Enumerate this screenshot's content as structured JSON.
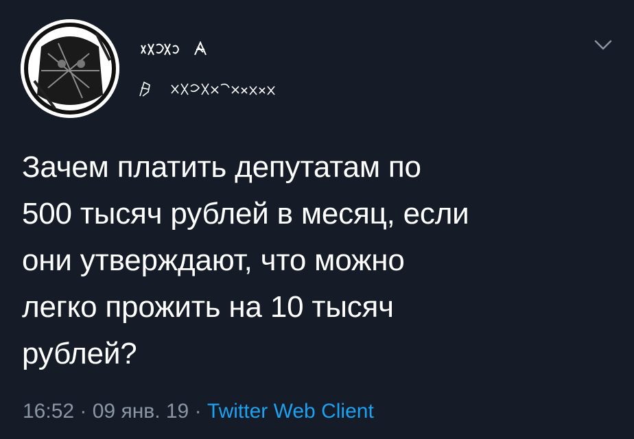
{
  "tweet": {
    "text": "Зачем платить депутатам по\n500 тысяч рублей в месяц, если\nони утверждают, что можно\nлегко прожить на 10 тысяч\nрублей?",
    "time": "16:52",
    "separator_1": " · ",
    "date": "09 янв. 19",
    "separator_2": " · ",
    "client": "Twitter Web Client"
  },
  "colors": {
    "background": "#151c27",
    "text": "#ffffff",
    "meta": "#8a96a3",
    "link": "#1da1f2"
  },
  "icons": {
    "more": "chevron-down-icon",
    "avatar": "avatar-image",
    "name": "scribbled-display-name",
    "handle": "scribbled-username"
  }
}
